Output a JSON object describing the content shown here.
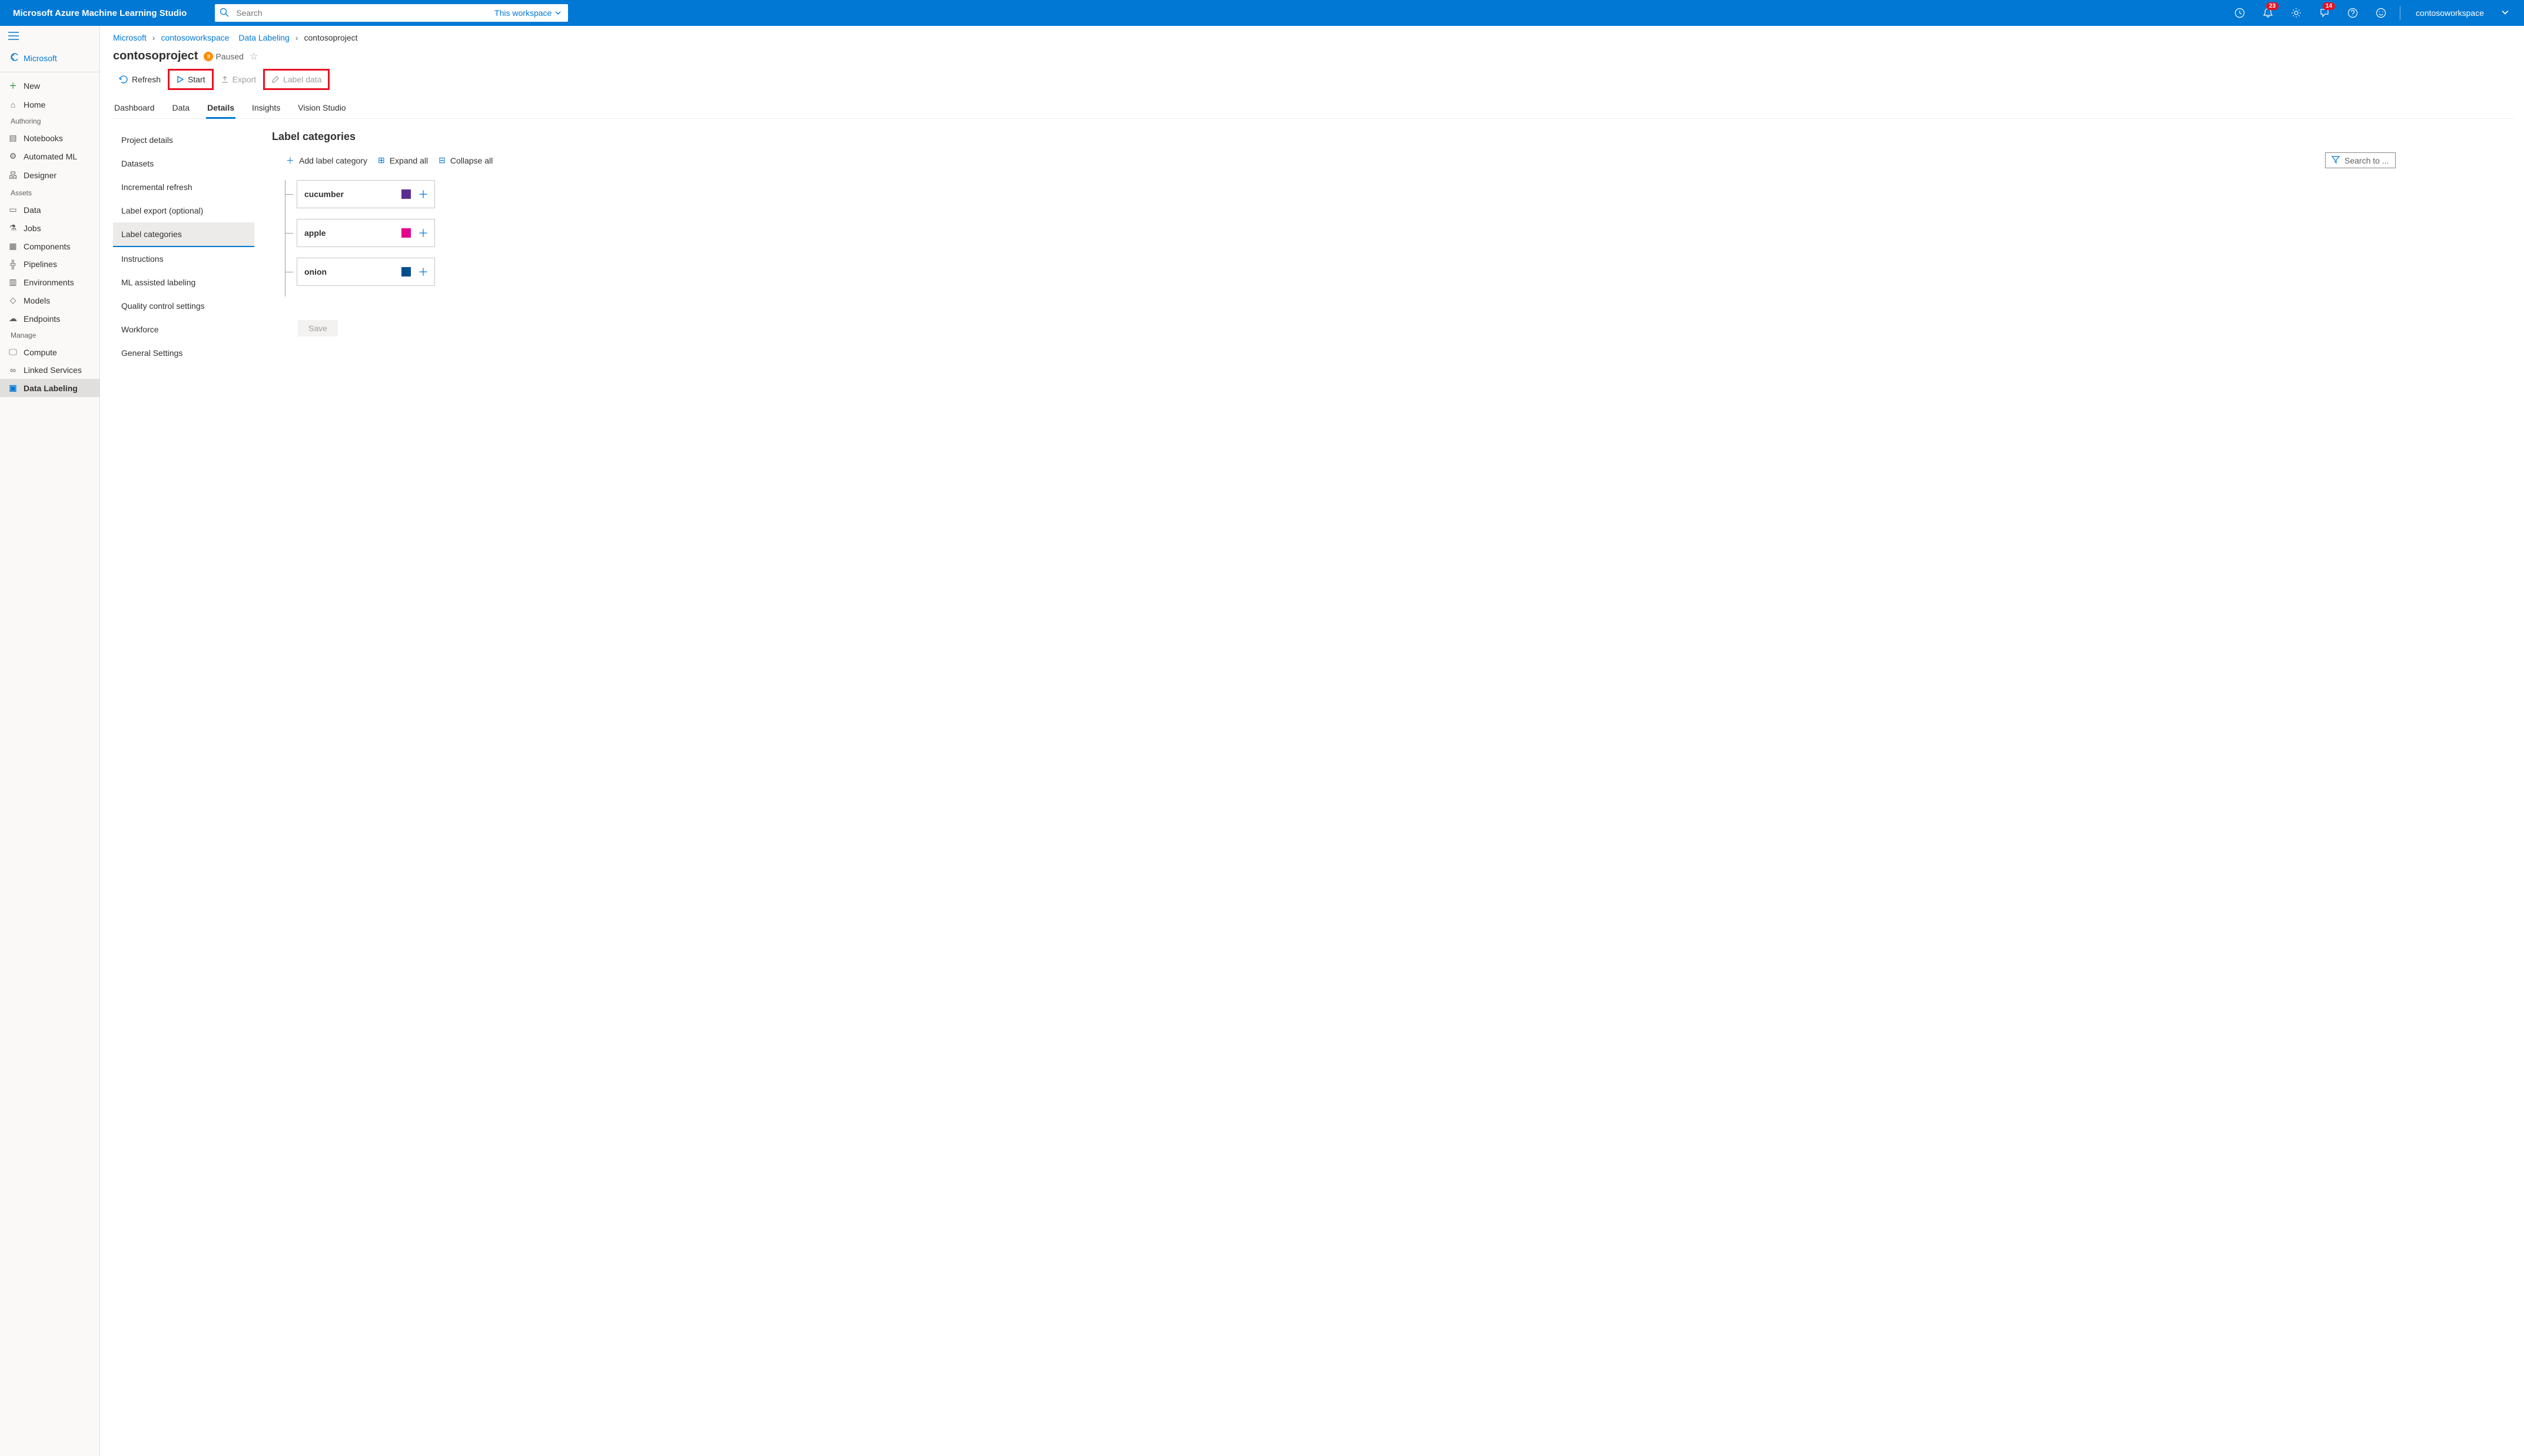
{
  "topbar": {
    "brand": "Microsoft Azure Machine Learning Studio",
    "search_placeholder": "Search",
    "scope_label": "This workspace",
    "notifications_badge": "23",
    "messages_badge": "14",
    "workspace": "contosoworkspace"
  },
  "nav": {
    "back": "Microsoft",
    "new": "New",
    "home": "Home",
    "section_authoring": "Authoring",
    "notebooks": "Notebooks",
    "automl": "Automated ML",
    "designer": "Designer",
    "section_assets": "Assets",
    "data": "Data",
    "jobs": "Jobs",
    "components": "Components",
    "pipelines": "Pipelines",
    "environments": "Environments",
    "models": "Models",
    "endpoints": "Endpoints",
    "section_manage": "Manage",
    "compute": "Compute",
    "linked_services": "Linked Services",
    "data_labeling": "Data Labeling"
  },
  "breadcrumbs": {
    "b1": "Microsoft",
    "b2": "contosoworkspace",
    "b3": "Data Labeling",
    "b4": "contosoproject"
  },
  "title": {
    "name": "contosoproject",
    "status": "Paused"
  },
  "toolbar": {
    "refresh": "Refresh",
    "start": "Start",
    "export": "Export",
    "label_data": "Label data"
  },
  "tabs": {
    "dashboard": "Dashboard",
    "data": "Data",
    "details": "Details",
    "insights": "Insights",
    "vision_studio": "Vision Studio"
  },
  "settings": {
    "project_details": "Project details",
    "datasets": "Datasets",
    "incremental": "Incremental refresh",
    "label_export": "Label export (optional)",
    "label_categories": "Label categories",
    "instructions": "Instructions",
    "ml_assisted": "ML assisted labeling",
    "quality": "Quality control settings",
    "workforce": "Workforce",
    "general": "General Settings"
  },
  "label_panel": {
    "heading": "Label categories",
    "add": "Add label category",
    "expand": "Expand all",
    "collapse": "Collapse all",
    "search_placeholder": "Search to ...",
    "labels": [
      {
        "name": "cucumber",
        "color": "#5c2d91"
      },
      {
        "name": "apple",
        "color": "#e3008c"
      },
      {
        "name": "onion",
        "color": "#004e8c"
      }
    ],
    "save": "Save"
  }
}
